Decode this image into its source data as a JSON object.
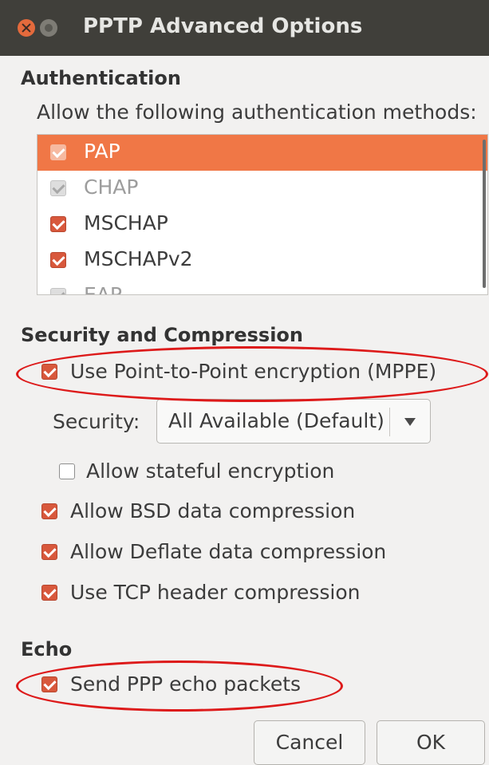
{
  "window": {
    "title": "PPTP Advanced Options"
  },
  "authentication": {
    "heading": "Authentication",
    "prompt": "Allow the following authentication methods:",
    "methods": [
      {
        "label": "PAP",
        "checked": true,
        "selected": true,
        "enabled": false
      },
      {
        "label": "CHAP",
        "checked": true,
        "selected": false,
        "enabled": false
      },
      {
        "label": "MSCHAP",
        "checked": true,
        "selected": false,
        "enabled": true
      },
      {
        "label": "MSCHAPv2",
        "checked": true,
        "selected": false,
        "enabled": true
      },
      {
        "label": "EAP",
        "checked": true,
        "selected": false,
        "enabled": false
      }
    ]
  },
  "security": {
    "heading": "Security and Compression",
    "mppe_label": "Use Point-to-Point encryption (MPPE)",
    "mppe_checked": true,
    "security_label": "Security:",
    "security_value": "All Available (Default)",
    "stateful_label": "Allow stateful encryption",
    "stateful_checked": false,
    "bsd_label": "Allow BSD data compression",
    "bsd_checked": true,
    "deflate_label": "Allow Deflate data compression",
    "deflate_checked": true,
    "tcp_label": "Use TCP header compression",
    "tcp_checked": true
  },
  "echo": {
    "heading": "Echo",
    "send_label": "Send PPP echo packets",
    "send_checked": true
  },
  "buttons": {
    "cancel": "Cancel",
    "ok": "OK"
  },
  "colors": {
    "accent": "#f07746",
    "checkbox": "#d8583c",
    "titlebar": "#403f3a",
    "highlight_ellipse": "#dd1a1a"
  }
}
